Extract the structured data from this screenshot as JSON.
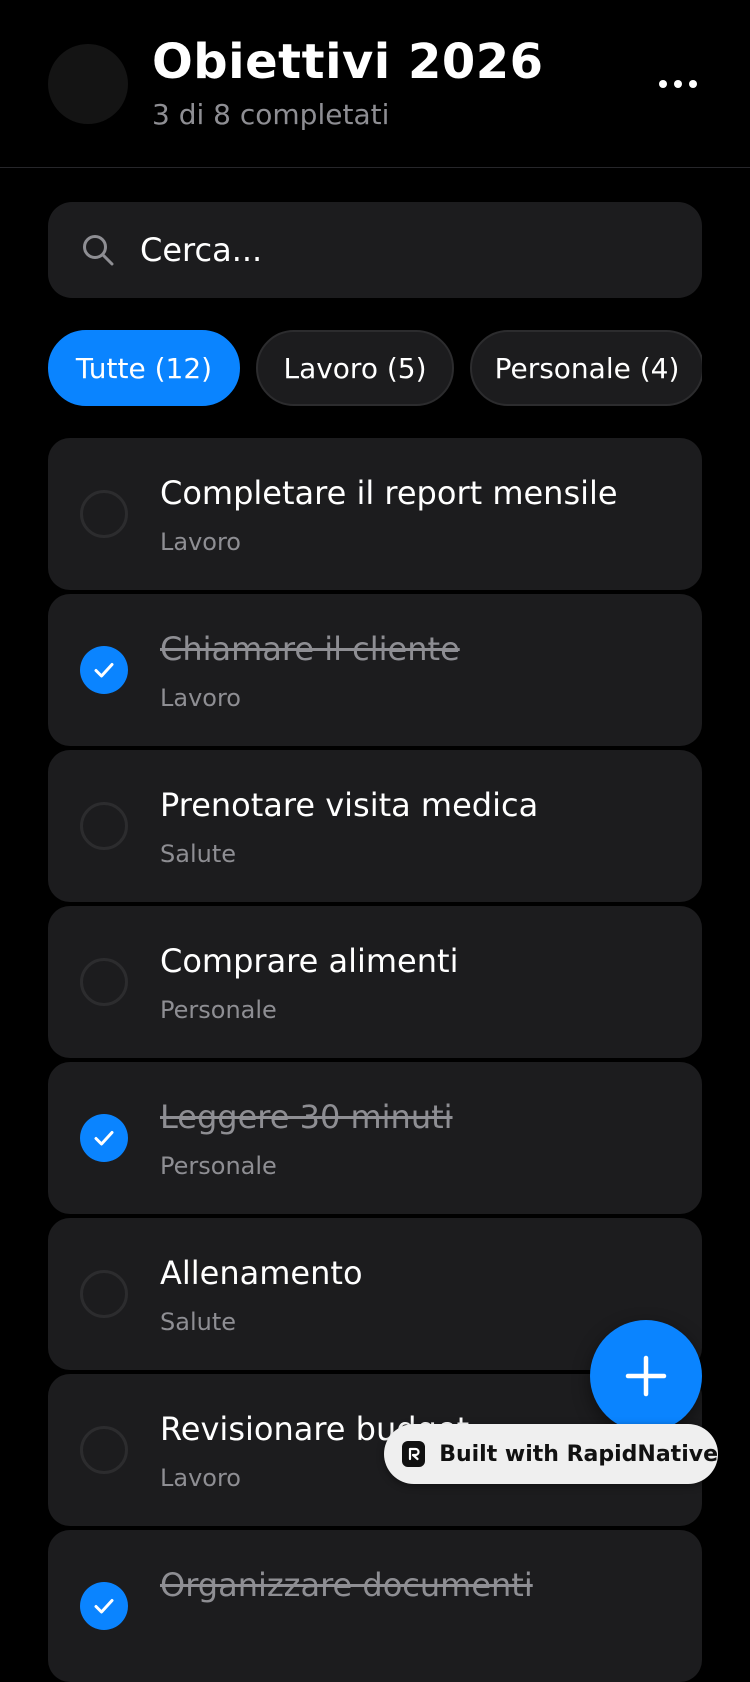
{
  "header": {
    "title": "Obiettivi 2026",
    "subtitle": "3 di 8 completati"
  },
  "search": {
    "placeholder": "Cerca..."
  },
  "filters": [
    {
      "label": "Tutte (12)",
      "active": true
    },
    {
      "label": "Lavoro (5)",
      "active": false
    },
    {
      "label": "Personale (4)",
      "active": false
    }
  ],
  "tasks": [
    {
      "title": "Completare il report mensile",
      "category": "Lavoro",
      "done": false
    },
    {
      "title": "Chiamare il cliente",
      "category": "Lavoro",
      "done": true
    },
    {
      "title": "Prenotare visita medica",
      "category": "Salute",
      "done": false
    },
    {
      "title": "Comprare alimenti",
      "category": "Personale",
      "done": false
    },
    {
      "title": "Leggere 30 minuti",
      "category": "Personale",
      "done": true
    },
    {
      "title": "Allenamento",
      "category": "Salute",
      "done": false
    },
    {
      "title": "Revisionare budget",
      "category": "Lavoro",
      "done": false
    },
    {
      "title": "Organizzare documenti",
      "category": "",
      "done": true
    }
  ],
  "badge": {
    "label": "Built with RapidNative"
  },
  "colors": {
    "accent": "#0a84ff",
    "background": "#000000",
    "card": "#1c1c1e",
    "muted_text": "#8e8e93"
  },
  "icons": {
    "search": "search-icon",
    "more": "more-horizontal-icon",
    "check": "checkmark-icon",
    "add": "plus-icon",
    "logo": "rapidnative-logo-icon"
  }
}
